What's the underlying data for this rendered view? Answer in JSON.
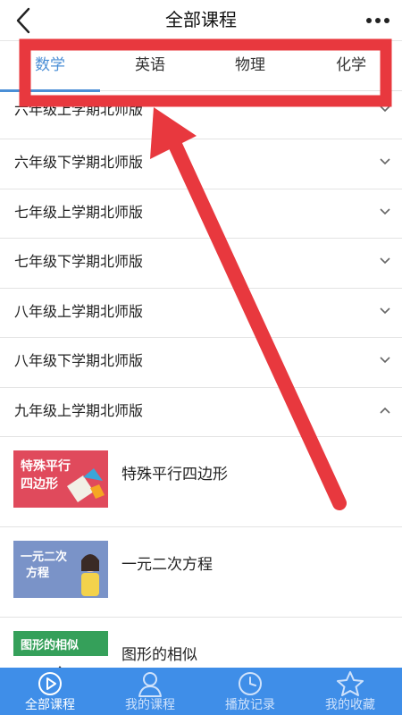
{
  "header": {
    "title": "全部课程",
    "back_icon": "chevron-left-icon",
    "more_icon": "more-dots-icon"
  },
  "tabs": [
    {
      "label": "数学",
      "active": true
    },
    {
      "label": "英语",
      "active": false
    },
    {
      "label": "物理",
      "active": false
    },
    {
      "label": "化学",
      "active": false
    }
  ],
  "grades": [
    {
      "label": "六年级上学期北师版",
      "expanded": false
    },
    {
      "label": "六年级下学期北师版",
      "expanded": false
    },
    {
      "label": "七年级上学期北师版",
      "expanded": false
    },
    {
      "label": "七年级下学期北师版",
      "expanded": false
    },
    {
      "label": "八年级上学期北师版",
      "expanded": false
    },
    {
      "label": "八年级下学期北师版",
      "expanded": false
    },
    {
      "label": "九年级上学期北师版",
      "expanded": true
    }
  ],
  "courses": [
    {
      "title": "特殊平行四边形",
      "thumb_text": [
        "特殊平行",
        "四边形"
      ],
      "thumb_bg": "#e04a5c"
    },
    {
      "title": "一元二次方程",
      "thumb_text": [
        "一元二次",
        "方程"
      ],
      "thumb_bg": "#7a93c8"
    },
    {
      "title": "图形的相似",
      "thumb_text": [
        "图形的相似"
      ],
      "thumb_bg": "#35a05a"
    }
  ],
  "bottom_nav": [
    {
      "label": "全部课程",
      "icon": "play-circle-icon",
      "active": true
    },
    {
      "label": "我的课程",
      "icon": "user-icon",
      "active": false
    },
    {
      "label": "播放记录",
      "icon": "clock-icon",
      "active": false
    },
    {
      "label": "我的收藏",
      "icon": "star-icon",
      "active": false
    }
  ],
  "colors": {
    "accent": "#4b8fd6",
    "nav_bg": "#3f8ee8",
    "annotation_red": "#e8383e"
  }
}
